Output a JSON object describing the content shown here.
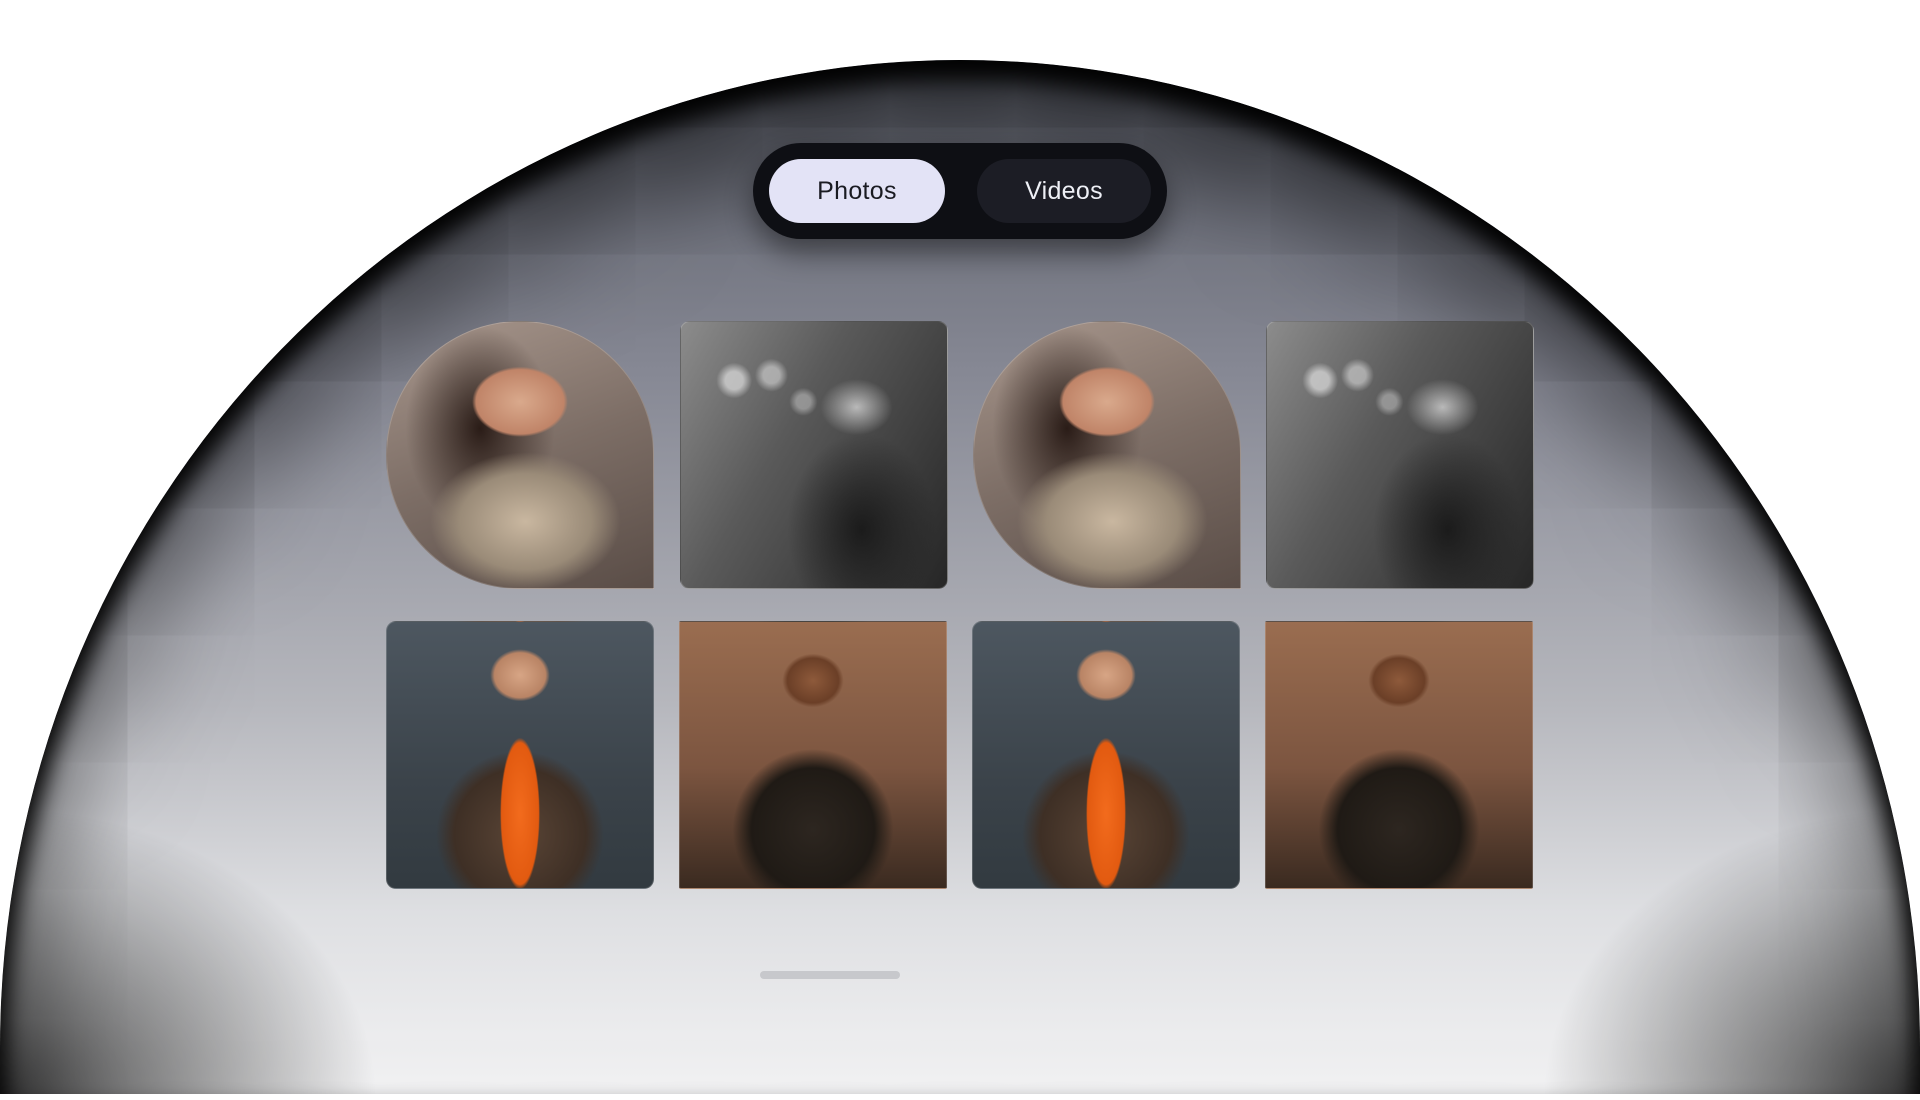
{
  "tabs": [
    {
      "label": "Photos",
      "selected": true
    },
    {
      "label": "Videos",
      "selected": false
    }
  ],
  "gallery": {
    "tiles": [
      {
        "subject": "woman-in-sequin-dress",
        "shape": "blob"
      },
      {
        "subject": "singer-with-microphone",
        "shape": "rounded"
      },
      {
        "subject": "woman-in-sequin-dress",
        "shape": "blob"
      },
      {
        "subject": "singer-with-microphone",
        "shape": "rounded"
      },
      {
        "subject": "man-in-orange-shirt",
        "shape": "rounded"
      },
      {
        "subject": "smiling-man-dark-shirt",
        "shape": "square"
      },
      {
        "subject": "man-in-orange-shirt",
        "shape": "rounded"
      },
      {
        "subject": "smiling-man-dark-shirt",
        "shape": "square"
      }
    ]
  },
  "pagination": {
    "active_index": 1
  },
  "colors": {
    "switcher_bg": "#0e0f14",
    "tab_selected_bg": "#e3e3f6",
    "tab_unselected_bg": "#1c1d25",
    "indicator": "#c7c8cc"
  }
}
